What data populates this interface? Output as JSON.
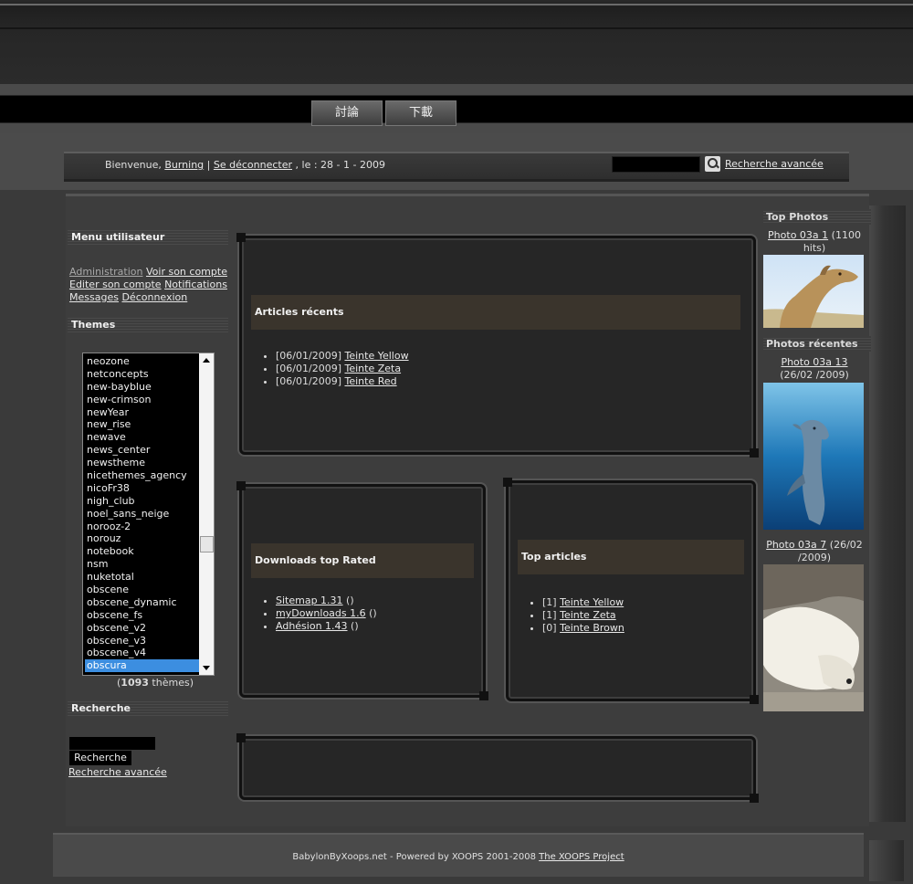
{
  "nav": {
    "items": [
      {
        "label": "討論"
      },
      {
        "label": "下載"
      }
    ]
  },
  "welcome": {
    "prefix": "Bienvenue,",
    "username": "Burning",
    "separator": "|",
    "logout": "Se déconnecter",
    "date_text": ", le : 28 - 1 - 2009"
  },
  "header_search": {
    "value": "",
    "advanced_link": "Recherche avancée"
  },
  "user_menu": {
    "title": "Menu utilisateur",
    "links": [
      "Administration",
      "Voir son compte",
      "Editer son compte",
      "Notifications",
      "Messages",
      "Déconnexion"
    ]
  },
  "themes": {
    "title": "Themes",
    "items": [
      "neozone",
      "netconcepts",
      "new-bayblue",
      "new-crimson",
      "newYear",
      "new_rise",
      "newave",
      "news_center",
      "newstheme",
      "nicethemes_agency",
      "nicoFr38",
      "nigh_club",
      "noel_sans_neige",
      "norooz-2",
      "norouz",
      "notebook",
      "nsm",
      "nuketotal",
      "obscene",
      "obscene_dynamic",
      "obscene_fs",
      "obscene_v2",
      "obscene_v3",
      "obscene_v4",
      "obscura"
    ],
    "selected": "obscura",
    "count": "1093",
    "count_suffix": "thèmes"
  },
  "search_block": {
    "title": "Recherche",
    "button": "Recherche",
    "advanced_link": "Recherche avancée"
  },
  "recent_articles": {
    "title": "Articles récents",
    "items": [
      {
        "date": "[06/01/2009]",
        "link": "Teinte Yellow"
      },
      {
        "date": "[06/01/2009]",
        "link": "Teinte Zeta"
      },
      {
        "date": "[06/01/2009]",
        "link": "Teinte Red"
      }
    ]
  },
  "downloads": {
    "title": "Downloads top Rated",
    "items": [
      {
        "link": "Sitemap 1.31",
        "suffix": " ()"
      },
      {
        "link": "myDownloads 1.6",
        "suffix": " ()"
      },
      {
        "link": "Adhésion 1.43",
        "suffix": " ()"
      }
    ]
  },
  "top_articles": {
    "title": "Top articles",
    "items": [
      {
        "count": "[1]",
        "link": "Teinte Yellow"
      },
      {
        "count": "[1]",
        "link": "Teinte Zeta"
      },
      {
        "count": "[0]",
        "link": "Teinte Brown"
      }
    ]
  },
  "top_photos": {
    "title": "Top Photos",
    "items": [
      {
        "link": "Photo 03a 1",
        "info": " (1100 hits)",
        "icon": "camel-photo"
      }
    ]
  },
  "recent_photos": {
    "title": "Photos récentes",
    "items": [
      {
        "link": "Photo 03a 13",
        "info": " (26/02 /2009)",
        "icon": "dolphin-photo"
      },
      {
        "link": "Photo 03a 7",
        "info": " (26/02 /2009)",
        "icon": "polar-bear-photo"
      }
    ]
  },
  "footer": {
    "text": "BabylonByXoops.net - Powered by XOOPS 2001-2008",
    "link": "The XOOPS Project"
  }
}
